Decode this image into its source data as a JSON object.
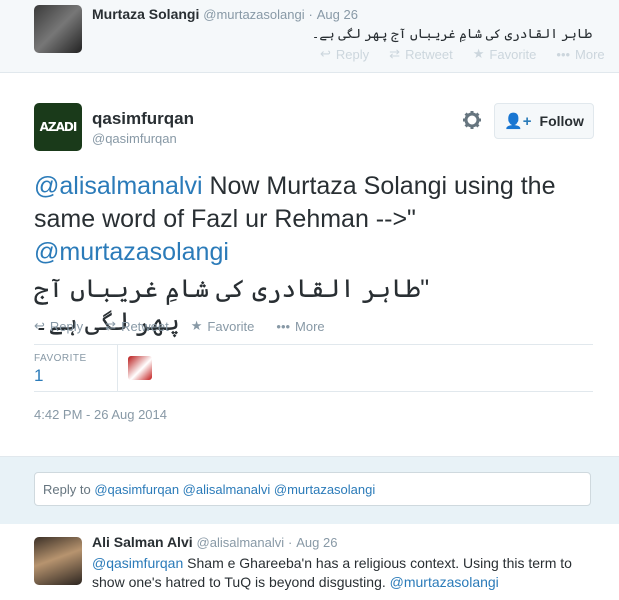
{
  "top_tweet": {
    "name": "Murtaza Solangi",
    "handle": "@murtazasolangi",
    "sep": "·",
    "time": "Aug 26",
    "text": "طاہر القادری کی شامِ غریباں آج پھر لگی ہے۔",
    "actions": {
      "reply": "Reply",
      "retweet": "Retweet",
      "favorite": "Favorite",
      "more": "More"
    }
  },
  "main_tweet": {
    "name": "qasimfurqan",
    "handle": "@qasimfurqan",
    "avatar_text": "AZADI",
    "follow_label": "Follow",
    "text_mention1": "@alisalmanalvi",
    "text_part1": " Now Murtaza Solangi using the same word of Fazl ur Rehman -->\"",
    "text_mention2": "@murtazasolangi",
    "text_urdu": "\"طاہر القادری کی شامِ غریباں آج پھر لگی ہے۔",
    "actions": {
      "reply": "Reply",
      "retweet": "Retweet",
      "favorite": "Favorite",
      "more": "More"
    },
    "stats_label": "FAVORITE",
    "stats_value": "1",
    "timestamp": "4:42 PM - 26 Aug 2014"
  },
  "reply_box": {
    "prefix": "Reply to ",
    "mentions": "@qasimfurqan @alisalmanalvi @murtazasolangi"
  },
  "bottom_tweet": {
    "name": "Ali Salman Alvi",
    "handle": "@alisalmanalvi",
    "sep": "·",
    "time": "Aug 26",
    "mention1": "@qasimfurqan",
    "text": " Sham e Ghareeba'n has a religious context. Using this term to show one's hatred to TuQ is beyond disgusting. ",
    "mention2": "@murtazasolangi"
  },
  "colors": {
    "link": "#2b7bb9",
    "muted": "#8899a6",
    "reply_bg": "#e8f2f7"
  }
}
